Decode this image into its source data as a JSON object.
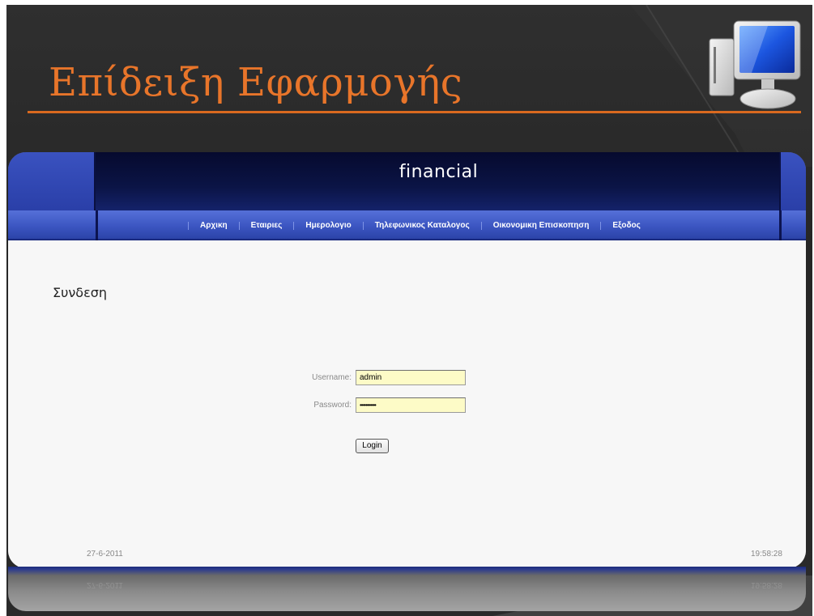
{
  "slide": {
    "title": "Επίδειξη Εφαρμογής"
  },
  "app": {
    "brand": "financial",
    "nav": [
      {
        "label": "Αρχικη"
      },
      {
        "label": "Εταιριες"
      },
      {
        "label": "Ημερολογιο"
      },
      {
        "label": "Τηλεφωνικος Καταλογος"
      },
      {
        "label": "Οικονομικη Επισκοπηση"
      },
      {
        "label": "Εξοδος"
      }
    ],
    "page_heading": "Συνδεση",
    "login_form": {
      "username_label": "Username:",
      "username_value": "admin",
      "password_label": "Password:",
      "password_value": "•••••••••••",
      "login_button": "Login"
    },
    "footer": {
      "date": "27-6-2011",
      "time": "19:58:28"
    }
  },
  "colors": {
    "title_orange": "#e8752a",
    "header_dark_navy": "#0b1446",
    "nav_blue": "#3c56c2",
    "input_yellow": "#fdfbc7"
  },
  "icons": {
    "slide_graphic": "computer-monitor-icon"
  }
}
